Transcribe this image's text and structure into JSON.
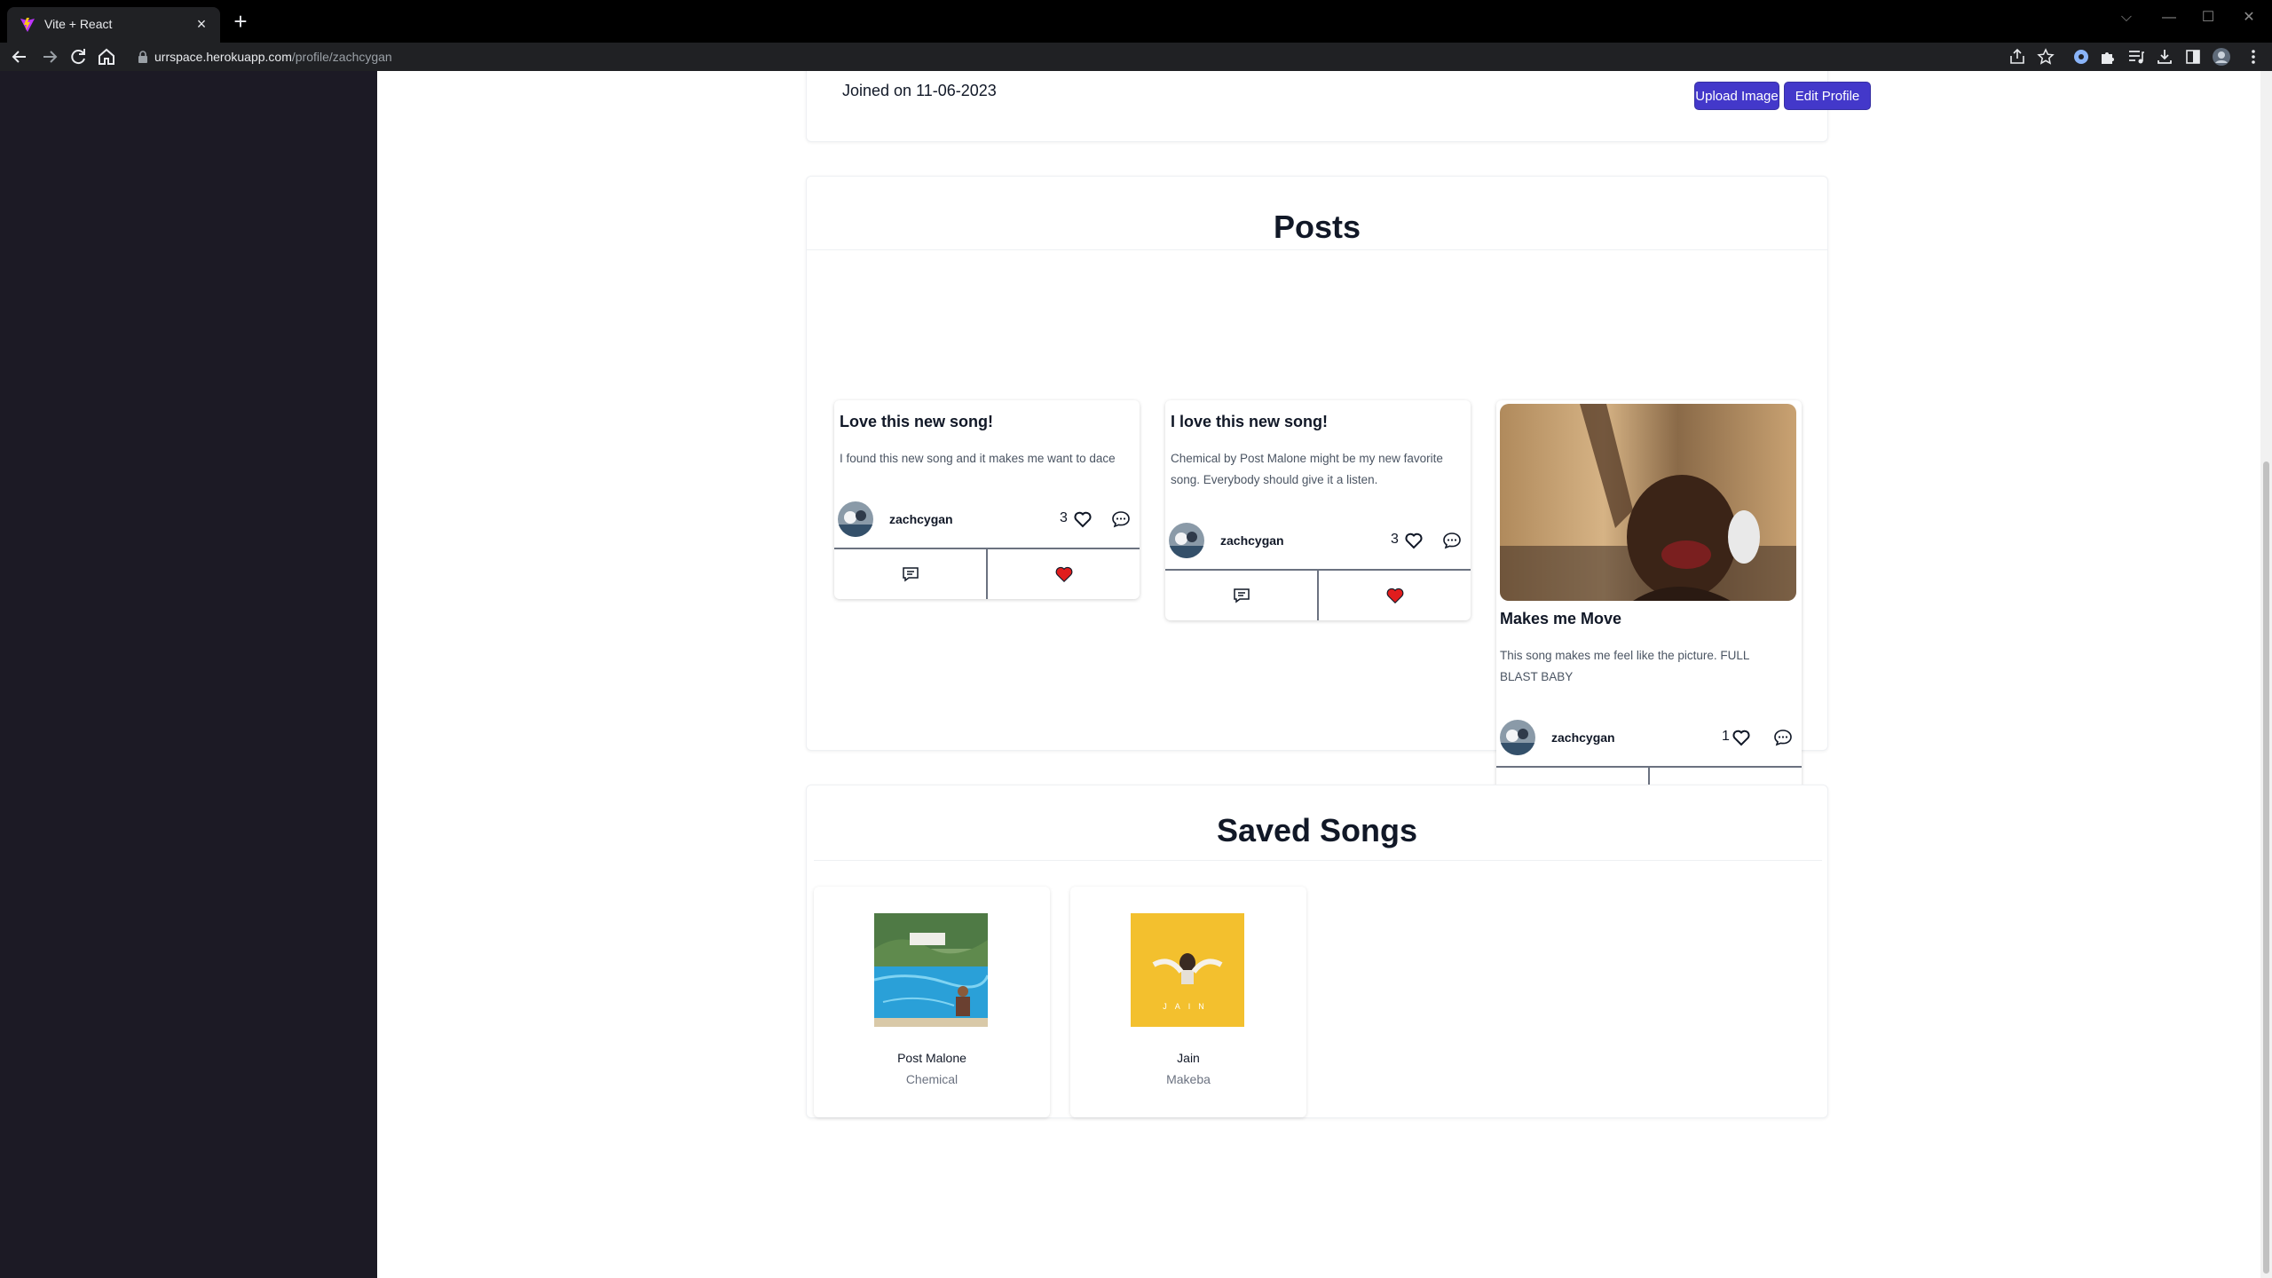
{
  "browser": {
    "tab_title": "Vite + React",
    "url_host": "urrspace.herokuapp.com",
    "url_path": "/profile/zachcygan"
  },
  "profile": {
    "joined_text": "Joined on 11-06-2023",
    "upload_image_label": "Upload Image",
    "edit_profile_label": "Edit Profile"
  },
  "posts_section": {
    "title": "Posts",
    "posts": [
      {
        "title": "Love this new song!",
        "body": "I found this new song and it makes me want to dace",
        "username": "zachcygan",
        "likes": "3",
        "has_image": false
      },
      {
        "title": "I love this new song!",
        "body": "Chemical by Post Malone might be my new favorite song. Everybody should give it a listen.",
        "username": "zachcygan",
        "likes": "3",
        "has_image": false
      },
      {
        "title": "Makes me Move",
        "body": "This song makes me feel like the picture. FULL BLAST BABY",
        "username": "zachcygan",
        "likes": "1",
        "has_image": true
      }
    ]
  },
  "saved_songs_section": {
    "title": "Saved Songs",
    "songs": [
      {
        "artist": "Post Malone",
        "title": "Chemical",
        "cover_text": ""
      },
      {
        "artist": "Jain",
        "title": "Makeba",
        "cover_text": "JAIN"
      }
    ]
  },
  "icons": {
    "heart_outline": "heart-outline-icon",
    "heart_filled": "heart-filled-icon",
    "comment": "comment-icon",
    "message": "message-square-icon"
  },
  "colors": {
    "sidebar_bg": "#1c1a25",
    "button_indigo": "#4338ca",
    "heart_red": "#e11d1d"
  }
}
